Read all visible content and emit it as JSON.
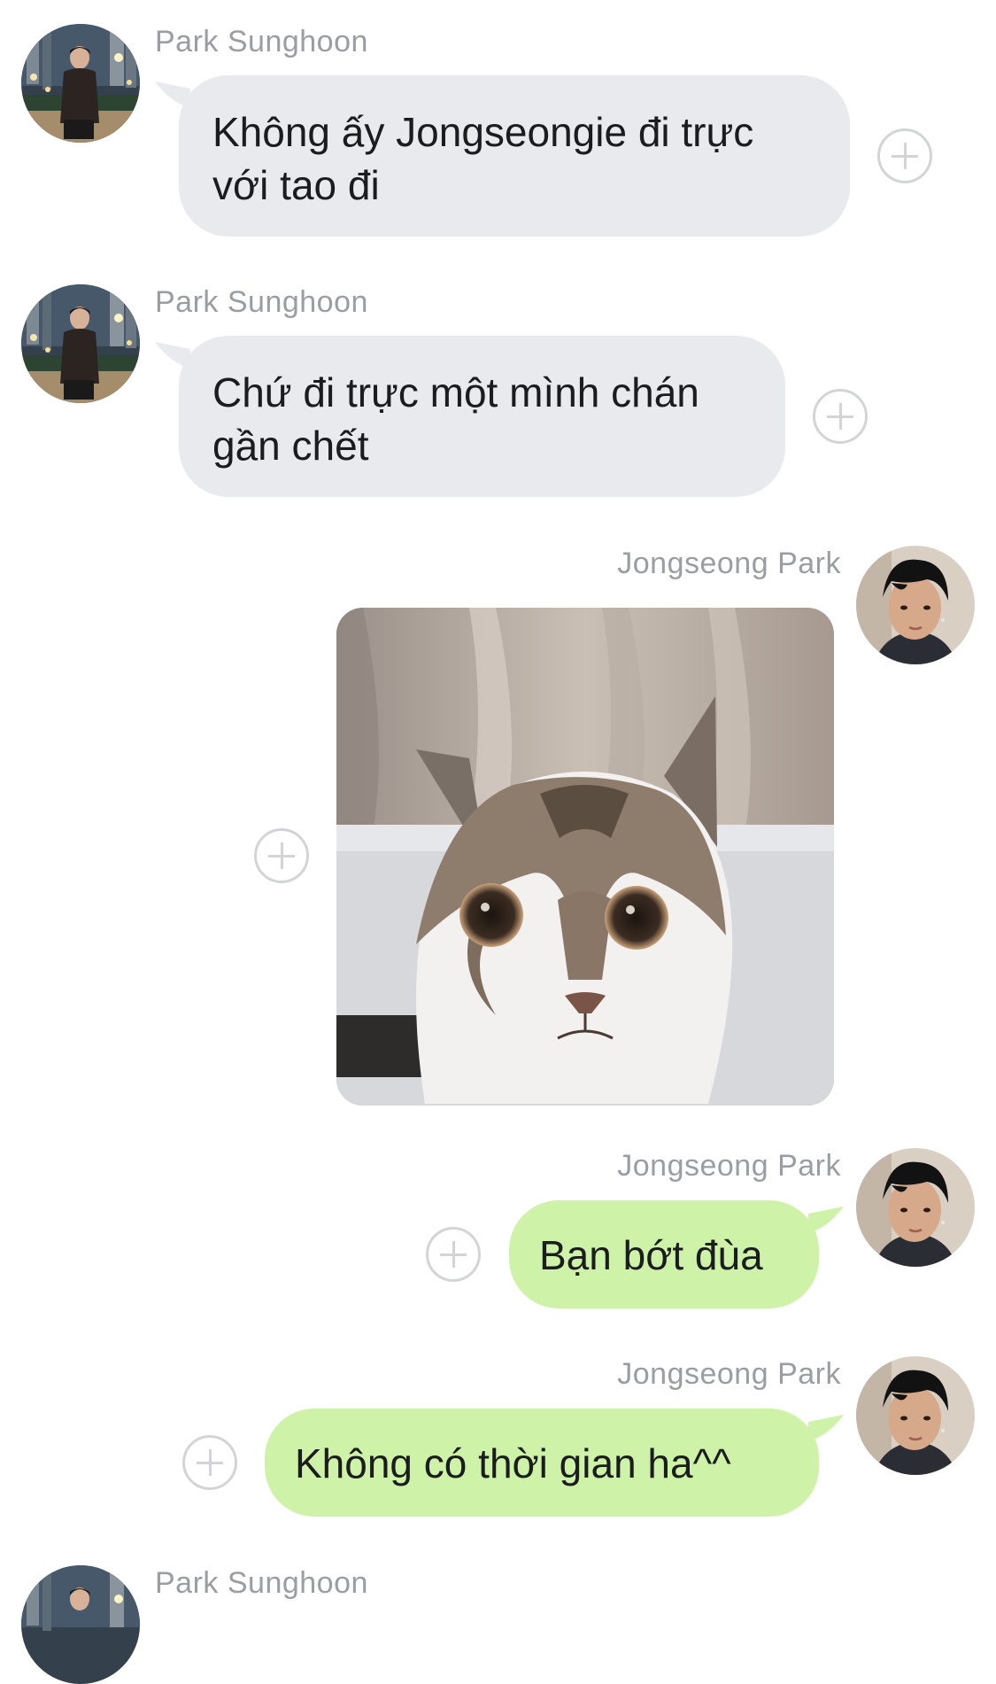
{
  "messages": [
    {
      "sender": "Park Sunghoon",
      "text": "Không ấy Jongseongie đi trực với tao đi"
    },
    {
      "sender": "Park Sunghoon",
      "text": "Chứ đi trực một mình chán gần chết"
    },
    {
      "sender": "Jongseong Park",
      "image": "cat-photo"
    },
    {
      "sender": "Jongseong Park",
      "text": "Bạn bớt đùa"
    },
    {
      "sender": "Jongseong Park",
      "text": "Không có thời gian ha^^"
    },
    {
      "sender": "Park Sunghoon"
    }
  ],
  "icons": {
    "add": "plus-circle-icon"
  },
  "colors": {
    "incoming_bubble": "#e8eaed",
    "outgoing_bubble": "#cdf2a8",
    "sender_name": "#9a9da3",
    "add_icon": "#d2d4d7"
  }
}
